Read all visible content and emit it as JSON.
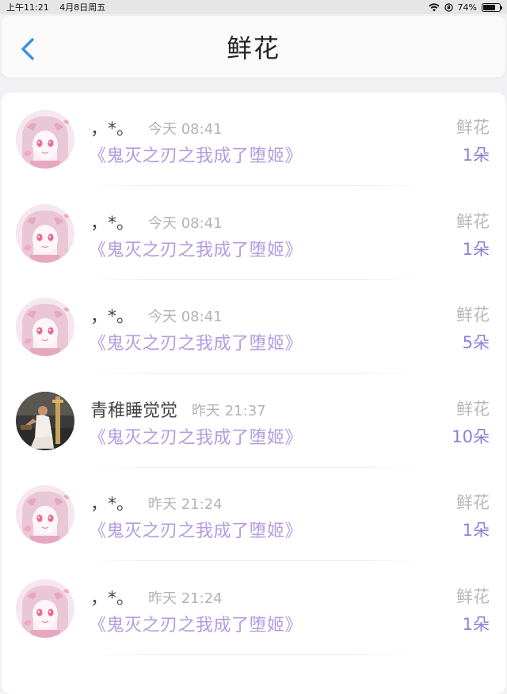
{
  "status_bar": {
    "time": "上午11:21",
    "date": "4月8日周五",
    "battery": "74%",
    "battery_level": 0.74
  },
  "header": {
    "title": "鲜花"
  },
  "items": [
    {
      "user": "，*。",
      "time": "今天 08:41",
      "book": "《鬼灭之刃之我成了堕姬》",
      "gift": "鲜花",
      "count": "1朵",
      "avatar": "anime-girl"
    },
    {
      "user": "，*。",
      "time": "今天 08:41",
      "book": "《鬼灭之刃之我成了堕姬》",
      "gift": "鲜花",
      "count": "1朵",
      "avatar": "anime-girl"
    },
    {
      "user": "，*。",
      "time": "今天 08:41",
      "book": "《鬼灭之刃之我成了堕姬》",
      "gift": "鲜花",
      "count": "5朵",
      "avatar": "anime-girl"
    },
    {
      "user": "青稚睡觉觉",
      "time": "昨天 21:37",
      "book": "《鬼灭之刃之我成了堕姬》",
      "gift": "鲜花",
      "count": "10朵",
      "avatar": "photo"
    },
    {
      "user": "，*。",
      "time": "昨天 21:24",
      "book": "《鬼灭之刃之我成了堕姬》",
      "gift": "鲜花",
      "count": "1朵",
      "avatar": "anime-girl"
    },
    {
      "user": "，*。",
      "time": "昨天 21:24",
      "book": "《鬼灭之刃之我成了堕姬》",
      "gift": "鲜花",
      "count": "1朵",
      "avatar": "anime-girl"
    }
  ],
  "colors": {
    "accent": "#3b8fe8",
    "book_title": "#b39ce0",
    "count": "#8b7fdb",
    "muted": "#b3b3b3"
  }
}
